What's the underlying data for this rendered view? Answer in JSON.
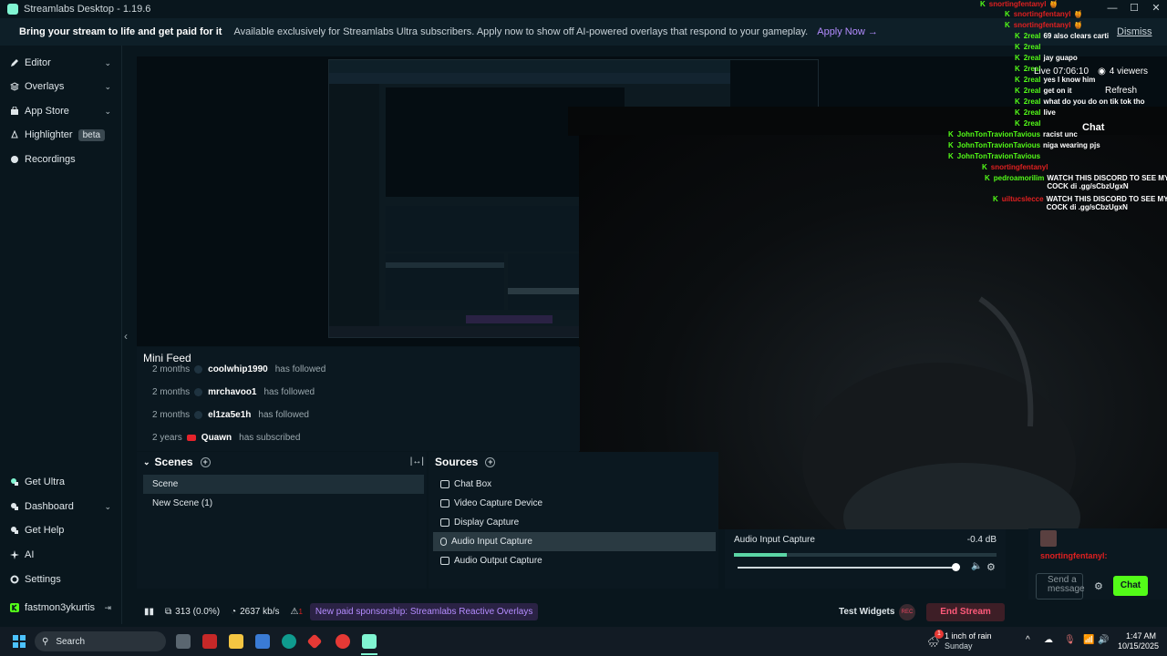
{
  "window": {
    "title": "Streamlabs Desktop - 1.19.6"
  },
  "banner": {
    "title": "Bring your stream to life and get paid for it",
    "text": "Available exclusively for Streamlabs Ultra subscribers. Apply now to show off AI-powered overlays that respond to your gameplay.",
    "apply": "Apply Now →",
    "dismiss": "Dismiss"
  },
  "sidebar": {
    "top": [
      {
        "label": "Editor",
        "icon": "editor-icon",
        "has_chevron": true
      },
      {
        "label": "Overlays",
        "icon": "overlays-icon",
        "has_chevron": true
      },
      {
        "label": "App Store",
        "icon": "app-store-icon",
        "has_chevron": true
      },
      {
        "label": "Highlighter",
        "icon": "highlighter-icon",
        "badge": "beta"
      },
      {
        "label": "Recordings",
        "icon": "recordings-icon"
      }
    ],
    "bottom": [
      {
        "label": "Get Ultra",
        "icon": "ultra-icon"
      },
      {
        "label": "Dashboard",
        "icon": "dashboard-icon",
        "has_chevron": true
      },
      {
        "label": "Get Help",
        "icon": "help-icon"
      },
      {
        "label": "AI",
        "icon": "ai-icon"
      },
      {
        "label": "Settings",
        "icon": "settings-icon"
      },
      {
        "label": "fastmon3ykurtis",
        "icon": "kick-icon"
      }
    ]
  },
  "mini_feed": {
    "title": "Mini Feed",
    "rows": [
      {
        "time": "2 months",
        "user": "coolwhip1990",
        "action": "has followed"
      },
      {
        "time": "2 months",
        "user": "mrchavoo1",
        "action": "has followed"
      },
      {
        "time": "2 months",
        "user": "el1za5e1h",
        "action": "has followed"
      },
      {
        "time": "2 years",
        "user": "Quawn",
        "action": "has subscribed"
      }
    ]
  },
  "scenes": {
    "title": "Scenes",
    "items": [
      "Scene",
      "New Scene (1)"
    ],
    "selected": 0
  },
  "sources": {
    "title": "Sources",
    "items": [
      "Chat Box",
      "Video Capture Device",
      "Display Capture",
      "Audio Input Capture",
      "Audio Output Capture"
    ],
    "selected": 3
  },
  "mixer": {
    "name": "Audio Input Capture",
    "db": "-0.4 dB",
    "level": 0.2,
    "volume": 1.0
  },
  "stream_status": {
    "live": "Live 07:06:10",
    "viewers": "4 viewers",
    "refresh": "Refresh",
    "chat": "Chat"
  },
  "chat_overlay": [
    {
      "user": "snortingfentanyl",
      "msg": "🍯",
      "color": "#e02020"
    },
    {
      "user": "snortingfentanyl",
      "msg": "🍯",
      "color": "#e02020"
    },
    {
      "user": "snortingfentanyl",
      "msg": "🍯",
      "color": "#e02020"
    },
    {
      "user": "2real",
      "msg": "69 also clears carti",
      "color": "#53fc18"
    },
    {
      "user": "2real",
      "msg": "",
      "color": "#53fc18"
    },
    {
      "user": "2real",
      "msg": "jay guapo",
      "color": "#53fc18"
    },
    {
      "user": "2real",
      "msg": "",
      "color": "#53fc18"
    },
    {
      "user": "2real",
      "msg": "yes I know him",
      "color": "#53fc18"
    },
    {
      "user": "2real",
      "msg": "get on it",
      "color": "#53fc18"
    },
    {
      "user": "2real",
      "msg": "what do you do on tik tok tho",
      "color": "#53fc18"
    },
    {
      "user": "2real",
      "msg": "live",
      "color": "#53fc18"
    },
    {
      "user": "2real",
      "msg": "",
      "color": "#53fc18"
    },
    {
      "user": "JohnTonTravionTavious",
      "msg": "racist unc",
      "color": "#53fc18"
    },
    {
      "user": "JohnTonTravionTavious",
      "msg": "niga wearing pjs",
      "color": "#53fc18"
    },
    {
      "user": "JohnTonTravionTavious",
      "msg": "",
      "color": "#53fc18"
    },
    {
      "user": "snortingfentanyl",
      "msg": "",
      "color": "#e02020"
    },
    {
      "user": "pedroamorilim",
      "msg": "WATCH THIS DISCORD TO SEE MY COCK di .gg/sCbzUgxN",
      "color": "#53fc18"
    },
    {
      "user": "uiltucslecce",
      "msg": "WATCH THIS DISCORD TO SEE MY COCK di .gg/sCbzUgxN",
      "color": "#e02020"
    }
  ],
  "chat_panel": {
    "last_user": "snortingfentanyl:",
    "input_placeholder": "Send a message",
    "send_label": "Chat"
  },
  "footer": {
    "frames": "313 (0.0%)",
    "bitrate": "2637 kb/s",
    "alerts": "1",
    "notification": "New paid sponsorship: Streamlabs Reactive Overlays",
    "test_widgets": "Test Widgets",
    "rec": "REC",
    "end_stream": "End Stream"
  },
  "taskbar": {
    "search": "Search",
    "weather_title": "1 inch of rain",
    "weather_sub": "Sunday",
    "weather_badge": "1",
    "time": "1:47 AM",
    "date": "10/15/2025"
  },
  "colors": {
    "accent": "#80f5d2",
    "kick_green": "#53fc18",
    "danger": "#ff5a7a",
    "purple": "#b48cff"
  }
}
